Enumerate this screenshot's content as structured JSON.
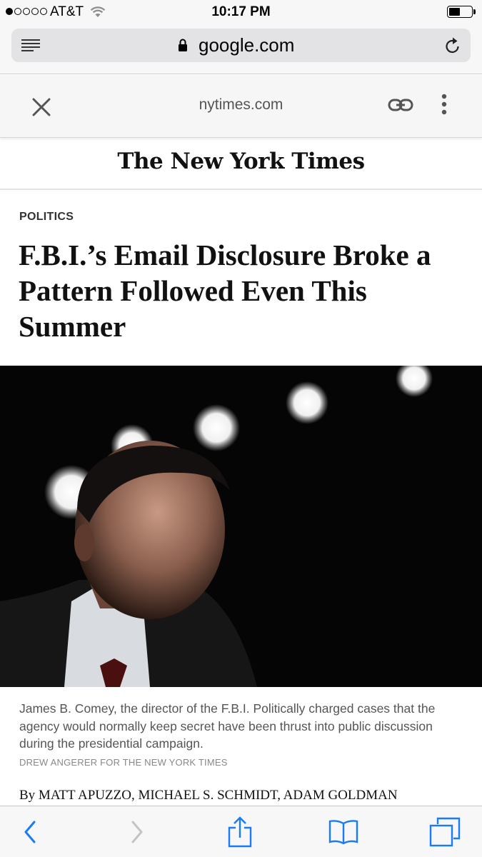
{
  "status_bar": {
    "carrier": "AT&T",
    "time": "10:17 PM",
    "signal_bars": 1,
    "signal_total": 5,
    "battery_level": 0.5
  },
  "safari": {
    "url": "google.com",
    "icons": [
      "reader-icon",
      "lock-icon",
      "reload-icon"
    ]
  },
  "amp_header": {
    "domain": "nytimes.com",
    "icons": [
      "close-icon",
      "link-icon",
      "more-vertical-icon"
    ]
  },
  "masthead": {
    "logo_text": "The New York Times"
  },
  "article": {
    "section": "POLITICS",
    "headline": "F.B.I.’s Email Disclosure Broke a Pattern Followed Even This Summer",
    "caption": "James B. Comey, the director of the F.B.I. Politically charged cases that the agency would normally keep secret have been thrust into public discussion during the presidential campaign.",
    "photo_credit": "DREW ANGERER FOR THE NEW YORK TIMES",
    "byline": "By MATT APUZZO, MICHAEL S. SCHMIDT, ADAM GOLDMAN"
  },
  "toolbar": {
    "icons": [
      "back-icon",
      "forward-icon",
      "share-icon",
      "bookmarks-icon",
      "tabs-icon"
    ]
  },
  "colors": {
    "ios_blue": "#1a7cf5",
    "disabled_gray": "#c4c4c4",
    "bar_background": "#f7f7f7"
  }
}
